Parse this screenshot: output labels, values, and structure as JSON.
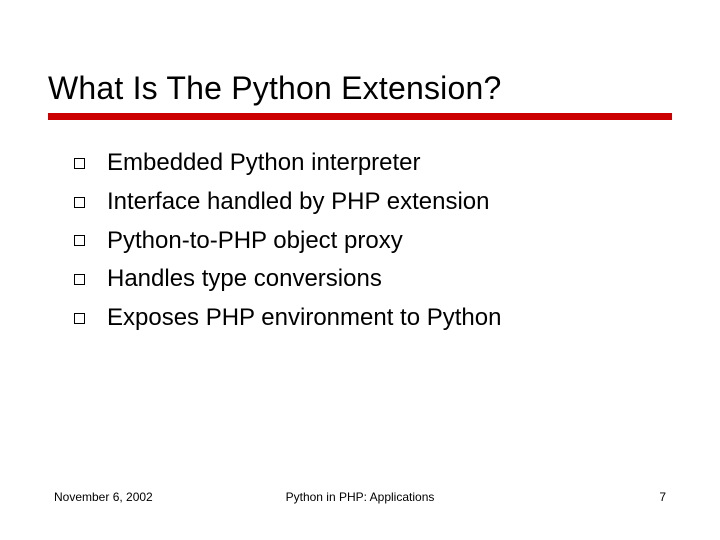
{
  "title": "What Is The Python Extension?",
  "bullets": [
    "Embedded Python interpreter",
    "Interface handled by PHP extension",
    "Python-to-PHP object proxy",
    "Handles type conversions",
    "Exposes PHP environment to Python"
  ],
  "footer": {
    "date": "November 6, 2002",
    "center": "Python in PHP: Applications",
    "page": "7"
  }
}
